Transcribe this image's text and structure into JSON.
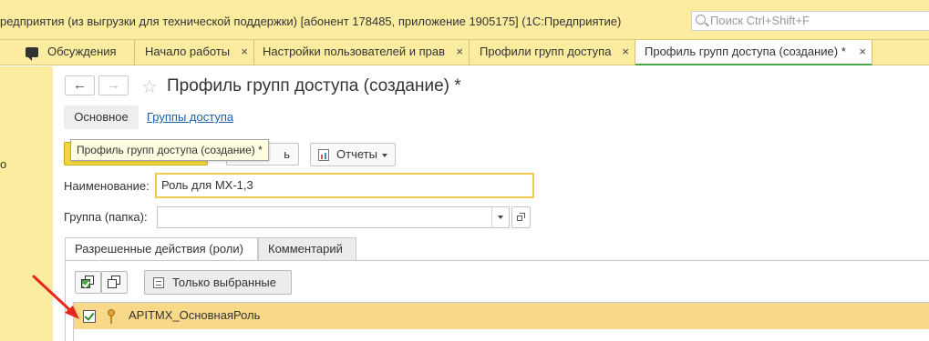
{
  "window": {
    "title": "редприятия (из выгрузки для технической поддержки) [абонент 178485, приложение 1905175]  (1С:Предприятие)",
    "search_placeholder": "Поиск Ctrl+Shift+F"
  },
  "tabs": [
    {
      "label": "Обсуждения",
      "close": ""
    },
    {
      "label": "Начало работы",
      "close": "×"
    },
    {
      "label": "Настройки пользователей и прав",
      "close": "×"
    },
    {
      "label": "Профили групп доступа",
      "close": "×"
    },
    {
      "label": "Профиль групп доступа (создание) *",
      "close": "×",
      "active": true
    }
  ],
  "left_panel": {
    "marker": "о"
  },
  "form": {
    "back": "←",
    "forward": "→",
    "star": "☆",
    "title": "Профиль групп доступа (создание) *",
    "sections": [
      {
        "label": "Основное",
        "current": true
      },
      {
        "label": "Группы доступа",
        "current": false
      }
    ],
    "toolbar": {
      "tooltip": "Профиль групп доступа (создание) *",
      "partial_button_label": "ь",
      "reports_label": "Отчеты"
    },
    "name_label": "Наименование:",
    "name_value": "Роль для МХ-1,3",
    "group_label": "Группа (папка):",
    "group_value": "",
    "page_tabs": [
      {
        "label": "Разрешенные действия (роли)",
        "current": true
      },
      {
        "label": "Комментарий",
        "current": false
      }
    ],
    "roles_toolbar": {
      "only_selected_label": "Только выбранные"
    },
    "roles": [
      {
        "checked": true,
        "name": "APITMX_ОсновнаяРоль"
      }
    ]
  },
  "colors": {
    "panel_yellow": "#fbeca0",
    "active_tab_underline": "#4aa74a",
    "selected_row": "#f8d989",
    "annotation_arrow": "#e8271c"
  }
}
